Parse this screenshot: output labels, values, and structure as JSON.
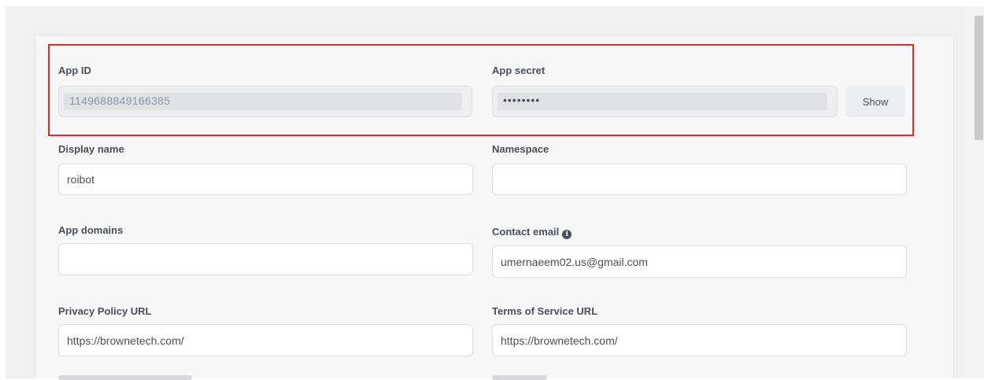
{
  "basic_settings": {
    "app_id": {
      "label": "App ID",
      "value": "1149688849166385"
    },
    "app_secret": {
      "label": "App secret",
      "value": "••••••••",
      "show_button": "Show"
    },
    "display_name": {
      "label": "Display name",
      "value": "roibot"
    },
    "namespace": {
      "label": "Namespace",
      "value": ""
    },
    "app_domains": {
      "label": "App domains",
      "value": ""
    },
    "contact_email": {
      "label": "Contact email",
      "value": "umernaeem02.us@gmail.com",
      "info_icon": "info-icon"
    },
    "privacy_policy_url": {
      "label": "Privacy Policy URL",
      "value": "https://brownetech.com/"
    },
    "terms_of_service_url": {
      "label": "Terms of Service URL",
      "value": "https://brownetech.com/"
    }
  },
  "colors": {
    "highlight_border": "#e32b2b",
    "label_text": "#4b4f56",
    "field_border": "#dadde1",
    "page_background": "#f0f0f0"
  }
}
